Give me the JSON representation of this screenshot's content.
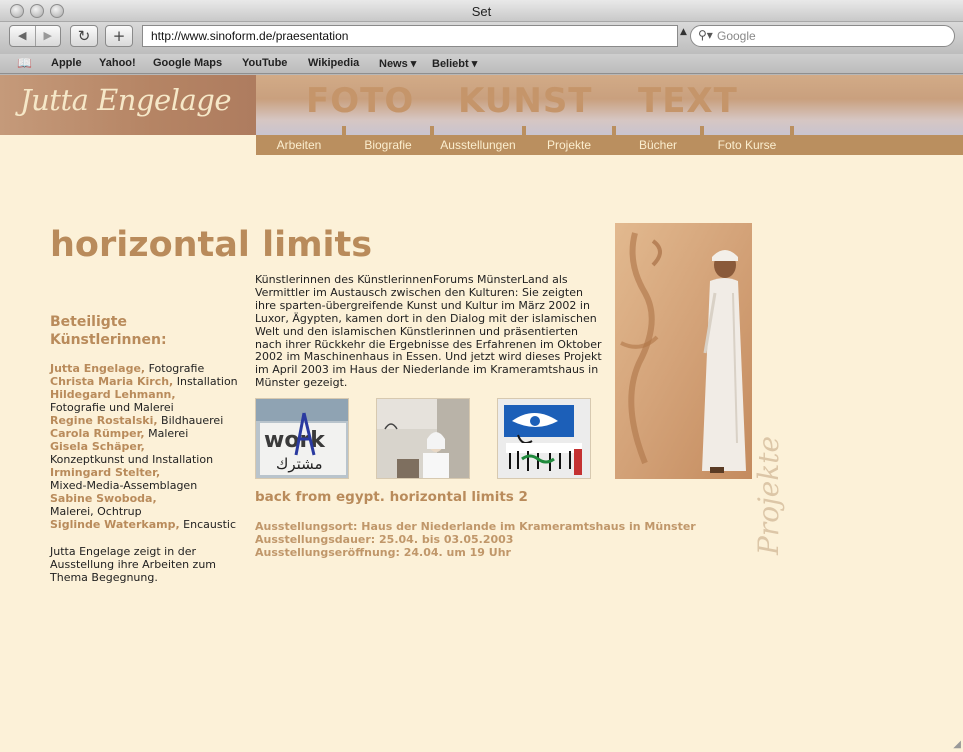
{
  "window": {
    "title": "Set"
  },
  "toolbar": {
    "back": "◀",
    "forward": "▶",
    "reload": "↻",
    "add": "+",
    "url": "http://www.sinoform.de/praesentation",
    "search_placeholder": "Google"
  },
  "bookmarks": [
    "Apple",
    "Yahoo!",
    "Google Maps",
    "YouTube",
    "Wikipedia",
    "News ▾",
    "Beliebt ▾"
  ],
  "site": {
    "logo": "Jutta Engelage",
    "tagline": [
      "FOTO",
      "KUNST",
      "TEXT"
    ],
    "menu": [
      "Arbeiten",
      "Biografie",
      "Ausstellungen",
      "Projekte",
      "Bücher",
      "Foto Kurse"
    ],
    "section_label": "Projekte"
  },
  "content": {
    "title": "horizontal limits",
    "participants_heading": "Beteiligte Künstlerinnen:",
    "artists": [
      {
        "name": "Jutta Engelage,",
        "medium": "Fotografie"
      },
      {
        "name": "Christa Maria Kirch,",
        "medium": "Installation"
      },
      {
        "name": "Hildegard Lehmann,",
        "medium": "Fotografie und Malerei"
      },
      {
        "name": "Regine Rostalski,",
        "medium": "Bildhauerei"
      },
      {
        "name": "Carola Rümper,",
        "medium": "Malerei"
      },
      {
        "name": "Gisela Schäper,",
        "medium": "Konzeptkunst und Installation"
      },
      {
        "name": "Irmingard Stelter,",
        "medium": "Mixed-Media-Assemblagen"
      },
      {
        "name": "Sabine Swoboda,",
        "medium": "Malerei, Ochtrup"
      },
      {
        "name": "Siglinde Waterkamp,",
        "medium": "Encaustic"
      }
    ],
    "note": "Jutta Engelage zeigt in der Ausstellung ihre Arbeiten zum Thema Begegnung.",
    "intro": "Künstlerinnen des KünstlerinnenForums MünsterLand als Vermittler im Austausch zwischen den Kulturen: Sie zeigten ihre sparten-übergreifende Kunst und Kultur im März 2002 in Luxor, Ägypten, kamen dort in den Dialog mit der islamischen Welt und den islamischen Künstlerinnen und präsentierten nach ihrer Rückkehr die Ergebnisse des Erfahrenen im Oktober 2002 im Maschinenhaus in Essen. Und jetzt wird dieses Projekt im April 2003 im Haus der Niederlande im Krameramtshaus in Münster gezeigt.",
    "subhead": "back from egypt. horizontal limits 2",
    "info": [
      "Ausstellungsort: Haus der Niederlande im Krameramtshaus in Münster",
      "Ausstellungsdauer: 25.04. bis 03.05.2003",
      "Ausstellungseröffnung: 24.04. um 19 Uhr"
    ],
    "thumb1_text": "work",
    "thumb1_arabic": "مشترك"
  }
}
